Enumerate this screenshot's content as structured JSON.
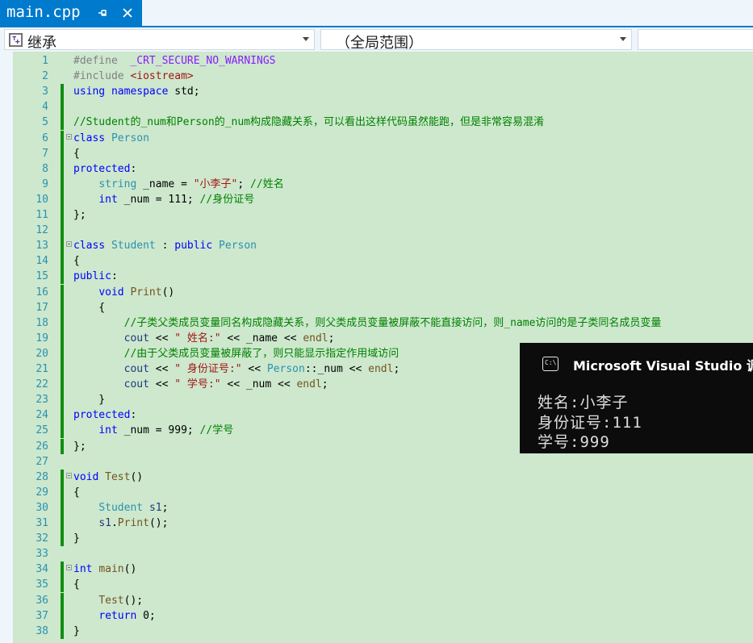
{
  "tab": {
    "title": "main.cpp"
  },
  "navbar": {
    "scope_left": "继承",
    "scope_right": "（全局范围）"
  },
  "code_lines": [
    {
      "n": "1",
      "tokens": [
        [
          "p",
          "#define  "
        ],
        [
          "m",
          "_CRT_SECURE_NO_WARNINGS"
        ]
      ]
    },
    {
      "n": "2",
      "tokens": [
        [
          "p",
          "#include "
        ],
        [
          "s",
          "<iostream>"
        ]
      ]
    },
    {
      "n": "3",
      "tokens": [
        [
          "k",
          "using"
        ],
        [
          "",
          " "
        ],
        [
          "k",
          "namespace"
        ],
        [
          "",
          " std;"
        ]
      ]
    },
    {
      "n": "4",
      "tokens": []
    },
    {
      "n": "5",
      "tokens": [
        [
          "c",
          "//Student的_num和Person的_num构成隐藏关系，可以看出这样代码虽然能跑，但是非常容易混淆"
        ]
      ]
    },
    {
      "n": "6",
      "tokens": [
        [
          "k",
          "class"
        ],
        [
          "",
          " "
        ],
        [
          "t",
          "Person"
        ]
      ]
    },
    {
      "n": "7",
      "tokens": [
        [
          "",
          "{"
        ]
      ]
    },
    {
      "n": "8",
      "tokens": [
        [
          "k",
          "protected"
        ],
        [
          "",
          ":"
        ]
      ]
    },
    {
      "n": "9",
      "tokens": [
        [
          "",
          "    "
        ],
        [
          "t",
          "string"
        ],
        [
          "",
          " _name = "
        ],
        [
          "s",
          "\"小李子\""
        ],
        [
          "",
          "; "
        ],
        [
          "c",
          "//姓名"
        ]
      ]
    },
    {
      "n": "10",
      "tokens": [
        [
          "",
          "    "
        ],
        [
          "k",
          "int"
        ],
        [
          "",
          " _num = 111; "
        ],
        [
          "c",
          "//身份证号"
        ]
      ]
    },
    {
      "n": "11",
      "tokens": [
        [
          "",
          "};"
        ]
      ]
    },
    {
      "n": "12",
      "tokens": []
    },
    {
      "n": "13",
      "tokens": [
        [
          "k",
          "class"
        ],
        [
          "",
          " "
        ],
        [
          "t",
          "Student"
        ],
        [
          "",
          " : "
        ],
        [
          "k",
          "public"
        ],
        [
          "",
          " "
        ],
        [
          "t",
          "Person"
        ]
      ]
    },
    {
      "n": "14",
      "tokens": [
        [
          "",
          "{"
        ]
      ]
    },
    {
      "n": "15",
      "tokens": [
        [
          "k",
          "public"
        ],
        [
          "",
          ":"
        ]
      ]
    },
    {
      "n": "16",
      "tokens": [
        [
          "",
          "    "
        ],
        [
          "k",
          "void"
        ],
        [
          "",
          " "
        ],
        [
          "f",
          "Print"
        ],
        [
          "",
          "()"
        ]
      ]
    },
    {
      "n": "17",
      "tokens": [
        [
          "",
          "    {"
        ]
      ]
    },
    {
      "n": "18",
      "tokens": [
        [
          "",
          "        "
        ],
        [
          "c",
          "//子类父类成员变量同名构成隐藏关系，则父类成员变量被屏蔽不能直接访问，则_name访问的是子类同名成员变量"
        ]
      ]
    },
    {
      "n": "19",
      "tokens": [
        [
          "",
          "        "
        ],
        [
          "v",
          "cout"
        ],
        [
          "",
          " << "
        ],
        [
          "s",
          "\" 姓名:\""
        ],
        [
          "",
          " << _name << "
        ],
        [
          "f",
          "endl"
        ],
        [
          "",
          ";"
        ]
      ]
    },
    {
      "n": "20",
      "tokens": [
        [
          "",
          "        "
        ],
        [
          "c",
          "//由于父类成员变量被屏蔽了，则只能显示指定作用域访问"
        ]
      ]
    },
    {
      "n": "21",
      "tokens": [
        [
          "",
          "        "
        ],
        [
          "v",
          "cout"
        ],
        [
          "",
          " << "
        ],
        [
          "s",
          "\" 身份证号:\""
        ],
        [
          "",
          " << "
        ],
        [
          "t",
          "Person"
        ],
        [
          "",
          "::_num << "
        ],
        [
          "f",
          "endl"
        ],
        [
          "",
          ";"
        ]
      ]
    },
    {
      "n": "22",
      "tokens": [
        [
          "",
          "        "
        ],
        [
          "v",
          "cout"
        ],
        [
          "",
          " << "
        ],
        [
          "s",
          "\" 学号:\""
        ],
        [
          "",
          " << _num << "
        ],
        [
          "f",
          "endl"
        ],
        [
          "",
          ";"
        ]
      ]
    },
    {
      "n": "23",
      "tokens": [
        [
          "",
          "    }"
        ]
      ]
    },
    {
      "n": "24",
      "tokens": [
        [
          "k",
          "protected"
        ],
        [
          "",
          ":"
        ]
      ]
    },
    {
      "n": "25",
      "tokens": [
        [
          "",
          "    "
        ],
        [
          "k",
          "int"
        ],
        [
          "",
          " _num = 999; "
        ],
        [
          "c",
          "//学号"
        ]
      ]
    },
    {
      "n": "26",
      "tokens": [
        [
          "",
          "};"
        ]
      ]
    },
    {
      "n": "27",
      "tokens": []
    },
    {
      "n": "28",
      "tokens": [
        [
          "k",
          "void"
        ],
        [
          "",
          " "
        ],
        [
          "f",
          "Test"
        ],
        [
          "",
          "()"
        ]
      ]
    },
    {
      "n": "29",
      "tokens": [
        [
          "",
          "{"
        ]
      ]
    },
    {
      "n": "30",
      "tokens": [
        [
          "",
          "    "
        ],
        [
          "t",
          "Student"
        ],
        [
          "",
          " "
        ],
        [
          "v",
          "s1"
        ],
        [
          "",
          ";"
        ]
      ]
    },
    {
      "n": "31",
      "tokens": [
        [
          "",
          "    "
        ],
        [
          "v",
          "s1"
        ],
        [
          "",
          "."
        ],
        [
          "f",
          "Print"
        ],
        [
          "",
          "();"
        ]
      ]
    },
    {
      "n": "32",
      "tokens": [
        [
          "",
          "}"
        ]
      ]
    },
    {
      "n": "33",
      "tokens": []
    },
    {
      "n": "34",
      "tokens": [
        [
          "k",
          "int"
        ],
        [
          "",
          " "
        ],
        [
          "f",
          "main"
        ],
        [
          "",
          "()"
        ]
      ]
    },
    {
      "n": "35",
      "tokens": [
        [
          "",
          "{"
        ]
      ]
    },
    {
      "n": "36",
      "tokens": [
        [
          "",
          "    "
        ],
        [
          "f",
          "Test"
        ],
        [
          "",
          "();"
        ]
      ]
    },
    {
      "n": "37",
      "tokens": [
        [
          "",
          "    "
        ],
        [
          "k",
          "return"
        ],
        [
          "",
          " 0;"
        ]
      ]
    },
    {
      "n": "38",
      "tokens": [
        [
          "",
          "}"
        ]
      ]
    }
  ],
  "console": {
    "title": "Microsoft Visual Studio 调试",
    "output": [
      "姓名:小李子",
      "身份证号:111",
      "学号:999"
    ]
  }
}
